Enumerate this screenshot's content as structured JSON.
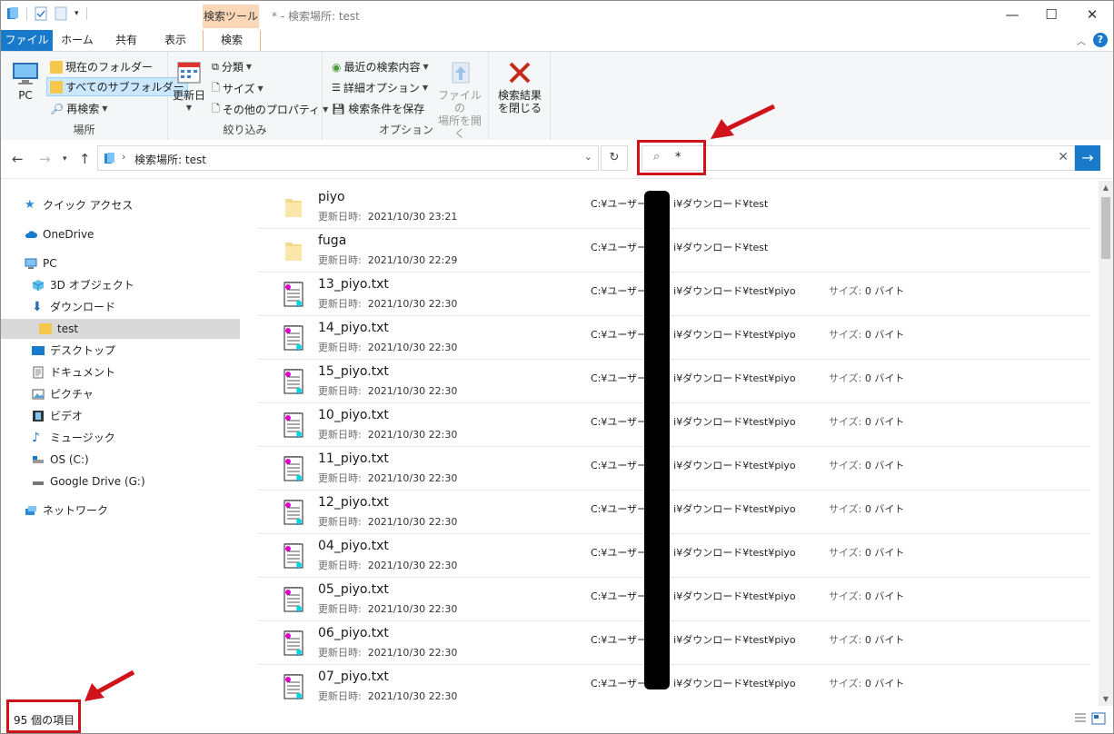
{
  "title_bar": {
    "context_tab_header": "検索ツール",
    "window_title": "* - 検索場所: test",
    "minimize": "—",
    "maximize": "☐",
    "close": "✕"
  },
  "ribbon_tabs": {
    "file": "ファイル",
    "home": "ホーム",
    "share": "共有",
    "view": "表示",
    "search": "検索"
  },
  "ribbon": {
    "location": {
      "pc": "PC",
      "current_folder": "現在のフォルダー",
      "all_subfolders": "すべてのサブフォルダー",
      "search_again": "再検索",
      "label": "場所"
    },
    "refine": {
      "date_modified": "更新日",
      "kind": "分類",
      "size": "サイズ",
      "other_properties": "その他のプロパティ",
      "label": "絞り込み"
    },
    "options": {
      "recent_searches": "最近の検索内容",
      "advanced_options": "詳細オプション",
      "save_search": "検索条件を保存",
      "open_file_location_1": "ファイルの",
      "open_file_location_2": "場所を開く",
      "label": "オプション"
    },
    "close": {
      "line1": "検索結果",
      "line2": "を閉じる"
    }
  },
  "address": {
    "path": "検索場所: test",
    "search_query": "*"
  },
  "sidebar": {
    "items": [
      {
        "label": "クイック アクセス",
        "icon": "star-icon"
      },
      {
        "label": "OneDrive",
        "icon": "cloud-icon"
      },
      {
        "label": "PC",
        "icon": "monitor-icon"
      },
      {
        "label": "3D オブジェクト",
        "icon": "cube-icon"
      },
      {
        "label": "ダウンロード",
        "icon": "download-icon"
      },
      {
        "label": "test",
        "icon": "folder-icon"
      },
      {
        "label": "デスクトップ",
        "icon": "desktop-icon"
      },
      {
        "label": "ドキュメント",
        "icon": "document-icon"
      },
      {
        "label": "ピクチャ",
        "icon": "picture-icon"
      },
      {
        "label": "ビデオ",
        "icon": "video-icon"
      },
      {
        "label": "ミュージック",
        "icon": "music-icon"
      },
      {
        "label": "OS (C:)",
        "icon": "drive-icon"
      },
      {
        "label": "Google Drive (G:)",
        "icon": "drive-icon"
      },
      {
        "label": "ネットワーク",
        "icon": "network-icon"
      }
    ]
  },
  "files": [
    {
      "name": "piyo",
      "modified_label": "更新日時:",
      "modified": "2021/10/30 23:21",
      "path_a": "C:¥ユーザー¥",
      "path_b": "i¥ダウンロード¥test",
      "size_label": "",
      "size": "",
      "type": "folder"
    },
    {
      "name": "fuga",
      "modified_label": "更新日時:",
      "modified": "2021/10/30 22:29",
      "path_a": "C:¥ユーザー¥",
      "path_b": "i¥ダウンロード¥test",
      "size_label": "",
      "size": "",
      "type": "folder"
    },
    {
      "name": "13_piyo.txt",
      "modified_label": "更新日時:",
      "modified": "2021/10/30 22:30",
      "path_a": "C:¥ユーザー¥",
      "path_b": "i¥ダウンロード¥test¥piyo",
      "size_label": "サイズ:",
      "size": "0 バイト",
      "type": "txt"
    },
    {
      "name": "14_piyo.txt",
      "modified_label": "更新日時:",
      "modified": "2021/10/30 22:30",
      "path_a": "C:¥ユーザー¥",
      "path_b": "i¥ダウンロード¥test¥piyo",
      "size_label": "サイズ:",
      "size": "0 バイト",
      "type": "txt"
    },
    {
      "name": "15_piyo.txt",
      "modified_label": "更新日時:",
      "modified": "2021/10/30 22:30",
      "path_a": "C:¥ユーザー¥",
      "path_b": "i¥ダウンロード¥test¥piyo",
      "size_label": "サイズ:",
      "size": "0 バイト",
      "type": "txt"
    },
    {
      "name": "10_piyo.txt",
      "modified_label": "更新日時:",
      "modified": "2021/10/30 22:30",
      "path_a": "C:¥ユーザー¥",
      "path_b": "i¥ダウンロード¥test¥piyo",
      "size_label": "サイズ:",
      "size": "0 バイト",
      "type": "txt"
    },
    {
      "name": "11_piyo.txt",
      "modified_label": "更新日時:",
      "modified": "2021/10/30 22:30",
      "path_a": "C:¥ユーザー¥",
      "path_b": "i¥ダウンロード¥test¥piyo",
      "size_label": "サイズ:",
      "size": "0 バイト",
      "type": "txt"
    },
    {
      "name": "12_piyo.txt",
      "modified_label": "更新日時:",
      "modified": "2021/10/30 22:30",
      "path_a": "C:¥ユーザー¥",
      "path_b": "i¥ダウンロード¥test¥piyo",
      "size_label": "サイズ:",
      "size": "0 バイト",
      "type": "txt"
    },
    {
      "name": "04_piyo.txt",
      "modified_label": "更新日時:",
      "modified": "2021/10/30 22:30",
      "path_a": "C:¥ユーザー¥",
      "path_b": "i¥ダウンロード¥test¥piyo",
      "size_label": "サイズ:",
      "size": "0 バイト",
      "type": "txt"
    },
    {
      "name": "05_piyo.txt",
      "modified_label": "更新日時:",
      "modified": "2021/10/30 22:30",
      "path_a": "C:¥ユーザー¥",
      "path_b": "i¥ダウンロード¥test¥piyo",
      "size_label": "サイズ:",
      "size": "0 バイト",
      "type": "txt"
    },
    {
      "name": "06_piyo.txt",
      "modified_label": "更新日時:",
      "modified": "2021/10/30 22:30",
      "path_a": "C:¥ユーザー¥",
      "path_b": "i¥ダウンロード¥test¥piyo",
      "size_label": "サイズ:",
      "size": "0 バイト",
      "type": "txt"
    },
    {
      "name": "07_piyo.txt",
      "modified_label": "更新日時:",
      "modified": "2021/10/30 22:30",
      "path_a": "C:¥ユーザー¥",
      "path_b": "i¥ダウンロード¥test¥piyo",
      "size_label": "サイズ:",
      "size": "0 バイト",
      "type": "txt"
    }
  ],
  "status": {
    "item_count": "95 個の項目"
  },
  "colors": {
    "accent": "#1979ca",
    "annotation": "#d0121b",
    "context_tab": "#f9d7b7"
  }
}
